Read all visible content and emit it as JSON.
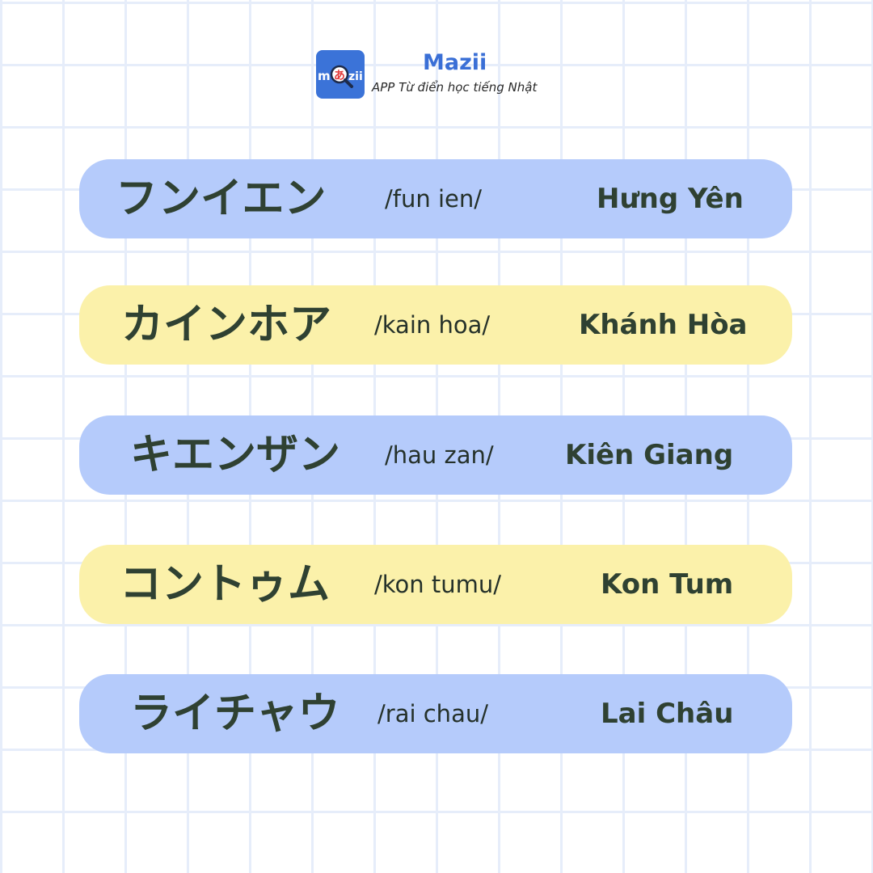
{
  "brand": {
    "name": "Mazii",
    "tagline": "APP Từ điển học tiếng Nhật",
    "logo_text": "m",
    "logo_kana": "あ",
    "logo_suffix": "zii",
    "logo_icon": "mazii-logo-icon",
    "accent_color": "#3b73d8"
  },
  "entries": [
    {
      "japanese": "フンイエン",
      "romaji": "/fun ien/",
      "vietnamese": "Hưng Yên",
      "color": "#b5cbfb"
    },
    {
      "japanese": "カインホア",
      "romaji": "/kain hoa/",
      "vietnamese": "Khánh Hòa",
      "color": "#fbf1aa"
    },
    {
      "japanese": "キエンザン",
      "romaji": "/hau zan/",
      "vietnamese": "Kiên Giang",
      "color": "#b5cbfb"
    },
    {
      "japanese": "コントゥム",
      "romaji": "/kon tumu/",
      "vietnamese": "Kon Tum",
      "color": "#fbf1aa"
    },
    {
      "japanese": "ライチャウ",
      "romaji": "/rai chau/",
      "vietnamese": "Lai Châu",
      "color": "#b5cbfb"
    }
  ]
}
